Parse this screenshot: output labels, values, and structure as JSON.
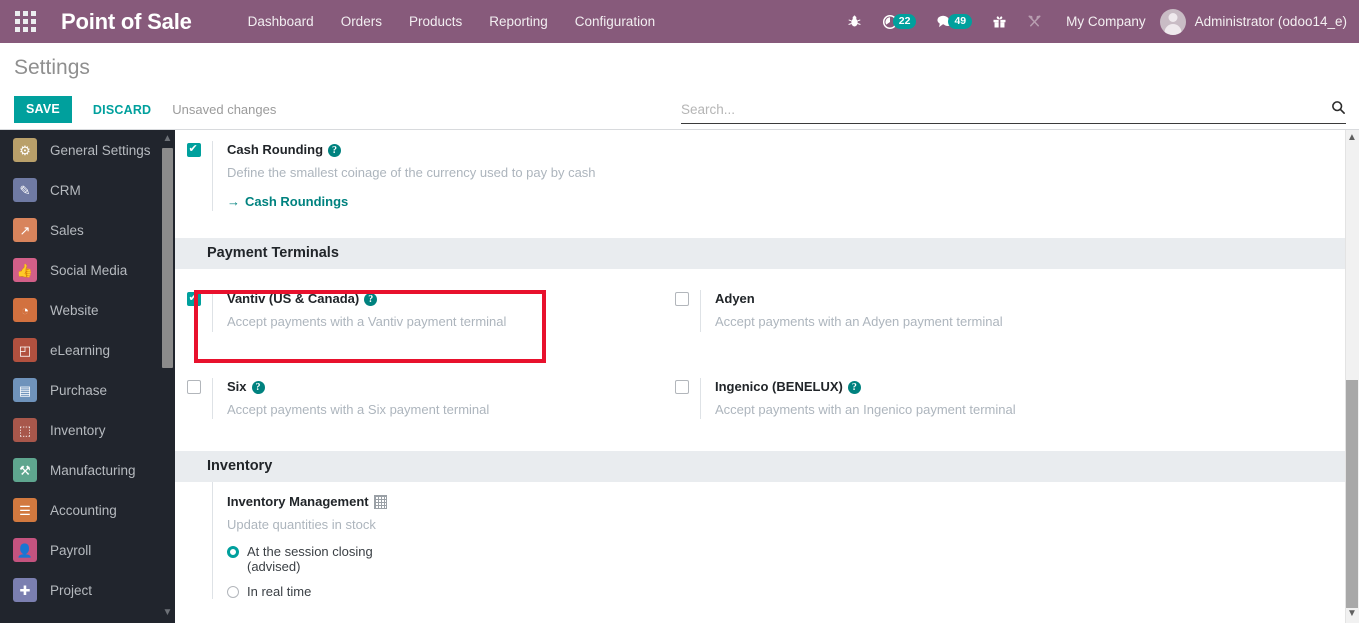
{
  "topbar": {
    "apps_icon": "apps-grid-icon",
    "brand": "Point of Sale",
    "menu": [
      {
        "label": "Dashboard"
      },
      {
        "label": "Orders"
      },
      {
        "label": "Products"
      },
      {
        "label": "Reporting"
      },
      {
        "label": "Configuration"
      }
    ],
    "sysicons": [
      {
        "name": "bug-icon",
        "glyph": "🐞",
        "badge": null
      },
      {
        "name": "activity-clock-icon",
        "glyph": "◔",
        "badge": "22"
      },
      {
        "name": "messages-icon",
        "glyph": "💬",
        "badge": "49"
      },
      {
        "name": "gift-icon",
        "glyph": "🎁",
        "badge": null
      },
      {
        "name": "tools-icon",
        "glyph": "⚒",
        "badge": null
      }
    ],
    "company": "My Company",
    "user": "Administrator (odoo14_e)",
    "accent": "#875A7B",
    "badge_color": "#00A09D"
  },
  "control_panel": {
    "title": "Settings",
    "save_label": "SAVE",
    "discard_label": "DISCARD",
    "status": "Unsaved changes",
    "save_color": "#00A09D"
  },
  "search": {
    "placeholder": "Search...",
    "value": "",
    "icon": "search-icon"
  },
  "sidebar": {
    "items": [
      {
        "label": "General Settings",
        "icon": "gear-icon",
        "glyph": "⚙",
        "bg": "#b9a06a"
      },
      {
        "label": "CRM",
        "icon": "handshake-icon",
        "glyph": "✎",
        "bg": "#6f7aa3"
      },
      {
        "label": "Sales",
        "icon": "chart-line-icon",
        "glyph": "↗",
        "bg": "#d8845c"
      },
      {
        "label": "Social Media",
        "icon": "thumbs-up-icon",
        "glyph": "👍",
        "bg": "#d25f88"
      },
      {
        "label": "Website",
        "icon": "globe-icon",
        "glyph": "◔",
        "bg": "#d2713f"
      },
      {
        "label": "eLearning",
        "icon": "presentation-icon",
        "glyph": "◰",
        "bg": "#b2513f"
      },
      {
        "label": "Purchase",
        "icon": "card-icon",
        "glyph": "▤",
        "bg": "#6f93bb"
      },
      {
        "label": "Inventory",
        "icon": "box-icon",
        "glyph": "⬚",
        "bg": "#a8574b"
      },
      {
        "label": "Manufacturing",
        "icon": "wrench-icon",
        "glyph": "⚒",
        "bg": "#5fa68f"
      },
      {
        "label": "Accounting",
        "icon": "invoice-icon",
        "glyph": "☰",
        "bg": "#d2793f"
      },
      {
        "label": "Payroll",
        "icon": "person-badge-icon",
        "glyph": "👤",
        "bg": "#c4537f"
      },
      {
        "label": "Project",
        "icon": "puzzle-icon",
        "glyph": "✚",
        "bg": "#7b7fb0"
      }
    ],
    "scroll": {
      "up_arrow": "▲",
      "down_arrow": "▼"
    }
  },
  "main": {
    "cash_rounding": {
      "checked": true,
      "title": "Cash Rounding",
      "help": "?",
      "description": "Define the smallest coinage of the currency used to pay by cash",
      "link": "Cash Roundings",
      "link_arrow": "→"
    },
    "payment_terminals": {
      "section_title": "Payment Terminals",
      "options": [
        {
          "title": "Vantiv (US & Canada)",
          "description": "Accept payments with a Vantiv payment terminal",
          "checked": true,
          "has_help": true,
          "highlighted": true
        },
        {
          "title": "Adyen",
          "description": "Accept payments with an Adyen payment terminal",
          "checked": false,
          "has_help": false,
          "highlighted": false
        },
        {
          "title": "Six",
          "description": "Accept payments with a Six payment terminal",
          "checked": false,
          "has_help": true,
          "highlighted": false
        },
        {
          "title": "Ingenico (BENELUX)",
          "description": "Accept payments with an Ingenico payment terminal",
          "checked": false,
          "has_help": true,
          "highlighted": false
        }
      ]
    },
    "inventory": {
      "section_title": "Inventory",
      "management": {
        "title": "Inventory Management",
        "icon": "company-building-icon",
        "description": "Update quantities in stock",
        "radios": [
          {
            "label": "At the session closing (advised)",
            "selected": true
          },
          {
            "label": "In real time",
            "selected": false
          }
        ]
      }
    },
    "help_glyph": "?"
  },
  "scrollbar": {
    "up_arrow": "▲",
    "down_arrow": "▼"
  },
  "annotation": {
    "color": "#e8112d"
  }
}
